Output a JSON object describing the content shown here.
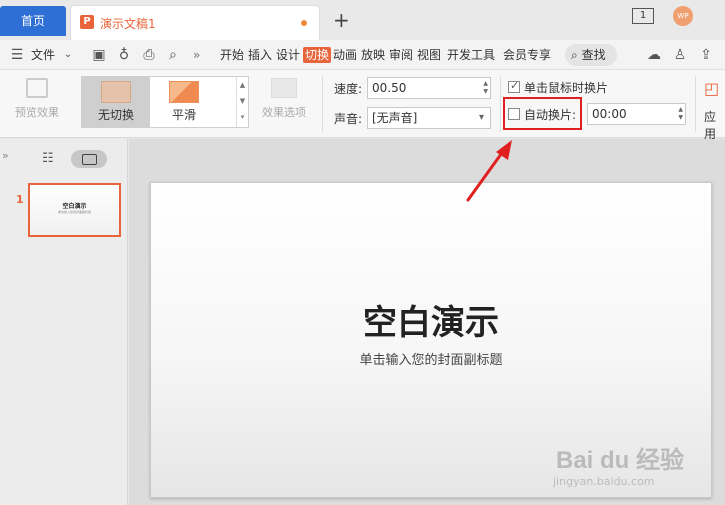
{
  "tabs": {
    "home": "首页",
    "doc": "演示文稿1",
    "plus": "+"
  },
  "window": {
    "page_indicator": "1",
    "avatar": "WP"
  },
  "menu": {
    "file": "文件",
    "items": [
      "开始",
      "插入",
      "设计",
      "切换",
      "动画",
      "放映",
      "审阅",
      "视图",
      "开发工具",
      "会员专享"
    ],
    "active": "切换",
    "search": "查找",
    "more": "»"
  },
  "ribbon": {
    "preview": "预览效果",
    "transitions": [
      "无切换",
      "平滑"
    ],
    "selected_transition": "无切换",
    "effect_options": "效果选项",
    "speed_label": "速度:",
    "speed_value": "00.50",
    "sound_label": "声音:",
    "sound_value": "[无声音]",
    "click_advance": "单击鼠标时换片",
    "click_advance_checked": true,
    "auto_advance": "自动换片:",
    "auto_advance_checked": false,
    "auto_time": "00:00",
    "apply_partial": "应用"
  },
  "panel": {
    "toggle": "»",
    "slide_number": "1",
    "thumb_title": "空白演示",
    "thumb_sub": "单击输入您的封面副标题"
  },
  "slide": {
    "title": "空白演示",
    "subtitle": "单击输入您的封面副标题"
  },
  "watermark": {
    "main": "Bai du 经验",
    "sub": "jingyan.baidu.com"
  },
  "colors": {
    "accent": "#e8643a",
    "home_tab": "#2e6fd6",
    "highlight": "#e02020"
  }
}
